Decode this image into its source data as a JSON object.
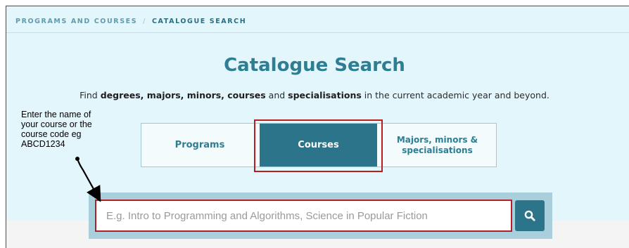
{
  "breadcrumb": {
    "items": [
      "PROGRAMS AND COURSES",
      "CATALOGUE SEARCH"
    ],
    "separator": "/"
  },
  "header": {
    "title": "Catalogue Search",
    "subtitle": {
      "t1": "Find ",
      "b1": "degrees, majors, minors, courses",
      "t2": " and ",
      "b2": "specialisations",
      "t3": " in the current academic year and beyond."
    }
  },
  "tabs": [
    {
      "label": "Programs",
      "active": false
    },
    {
      "label": "Courses",
      "active": true
    },
    {
      "label": "Majors, minors & specialisations",
      "active": false
    }
  ],
  "search": {
    "placeholder": "E.g. Intro to Programming and Algorithms, Science in Popular Fiction",
    "value": "",
    "button_icon": "search-icon"
  },
  "annotation": {
    "text": "Enter the name of\nyour course or the\ncourse code eg\nABCD1234"
  },
  "colors": {
    "accent": "#2b7489",
    "hero_background": "#e3f6fb",
    "highlight": "#b51f24"
  }
}
